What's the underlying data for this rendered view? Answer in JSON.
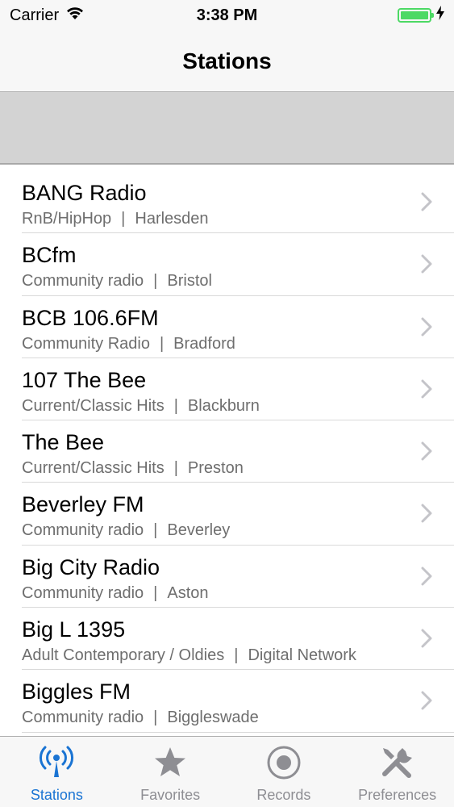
{
  "status_bar": {
    "carrier": "Carrier",
    "time": "3:38 PM",
    "battery_level": 1.0,
    "battery_color": "#4cd964"
  },
  "nav": {
    "title": "Stations"
  },
  "stations": [
    {
      "name": "BANG Radio",
      "genre": "RnB/HipHop",
      "location": "Harlesden"
    },
    {
      "name": "BCfm",
      "genre": "Community radio",
      "location": "Bristol"
    },
    {
      "name": "BCB 106.6FM",
      "genre": "Community Radio",
      "location": "Bradford"
    },
    {
      "name": "107 The Bee",
      "genre": "Current/Classic Hits",
      "location": "Blackburn"
    },
    {
      "name": "The Bee",
      "genre": "Current/Classic Hits",
      "location": "Preston"
    },
    {
      "name": "Beverley FM",
      "genre": "Community radio",
      "location": "Beverley"
    },
    {
      "name": "Big City Radio",
      "genre": "Community radio",
      "location": "Aston"
    },
    {
      "name": "Big L 1395",
      "genre": "Adult Contemporary / Oldies",
      "location": "Digital Network"
    },
    {
      "name": "Biggles FM",
      "genre": "Community radio",
      "location": "Biggleswade"
    }
  ],
  "separator": "|",
  "tabs": [
    {
      "label": "Stations",
      "icon": "antenna-icon",
      "active": true
    },
    {
      "label": "Favorites",
      "icon": "star-icon",
      "active": false
    },
    {
      "label": "Records",
      "icon": "record-icon",
      "active": false
    },
    {
      "label": "Preferences",
      "icon": "tools-icon",
      "active": false
    }
  ],
  "colors": {
    "accent": "#1a74d3",
    "inactive_tab": "#8e8e93",
    "subtitle": "#6e6e6e"
  }
}
